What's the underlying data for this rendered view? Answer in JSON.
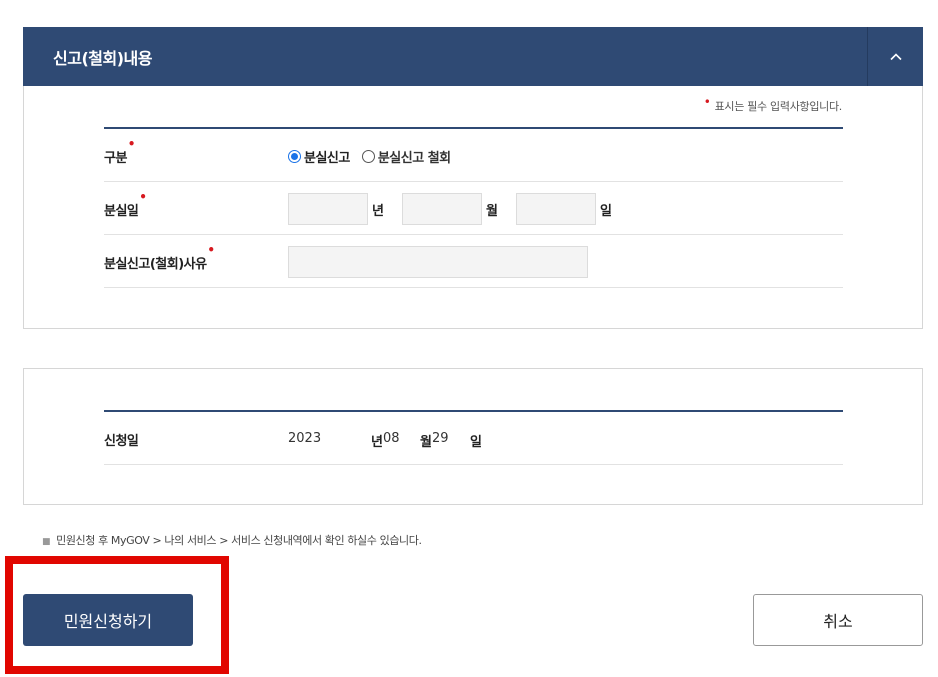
{
  "section": {
    "title": "신고(철회)내용",
    "collapse_icon": "chevron-up-icon"
  },
  "required_note": {
    "marker": "•",
    "text": "표시는 필수 입력사항입니다."
  },
  "form": {
    "type": {
      "label": "구분",
      "options": [
        {
          "label": "분실신고",
          "checked": true
        },
        {
          "label": "분실신고 철회",
          "checked": false
        }
      ]
    },
    "lost_date": {
      "label": "분실일",
      "units": [
        "년",
        "월",
        "일"
      ],
      "values": [
        "",
        "",
        ""
      ]
    },
    "reason": {
      "label": "분실신고(철회)사유",
      "value": ""
    }
  },
  "application": {
    "label": "신청일",
    "year": "2023",
    "year_unit": "년",
    "month": "08",
    "month_unit": "월",
    "day": "29",
    "day_unit": "일"
  },
  "notice": "민원신청 후 MyGOV > 나의 서비스 > 서비스 신청내역에서 확인 하실수 있습니다.",
  "buttons": {
    "submit": "민원신청하기",
    "cancel": "취소"
  },
  "colors": {
    "header_bg": "#2f4a74",
    "required_dot": "#d71920",
    "highlight": "#e10600"
  }
}
